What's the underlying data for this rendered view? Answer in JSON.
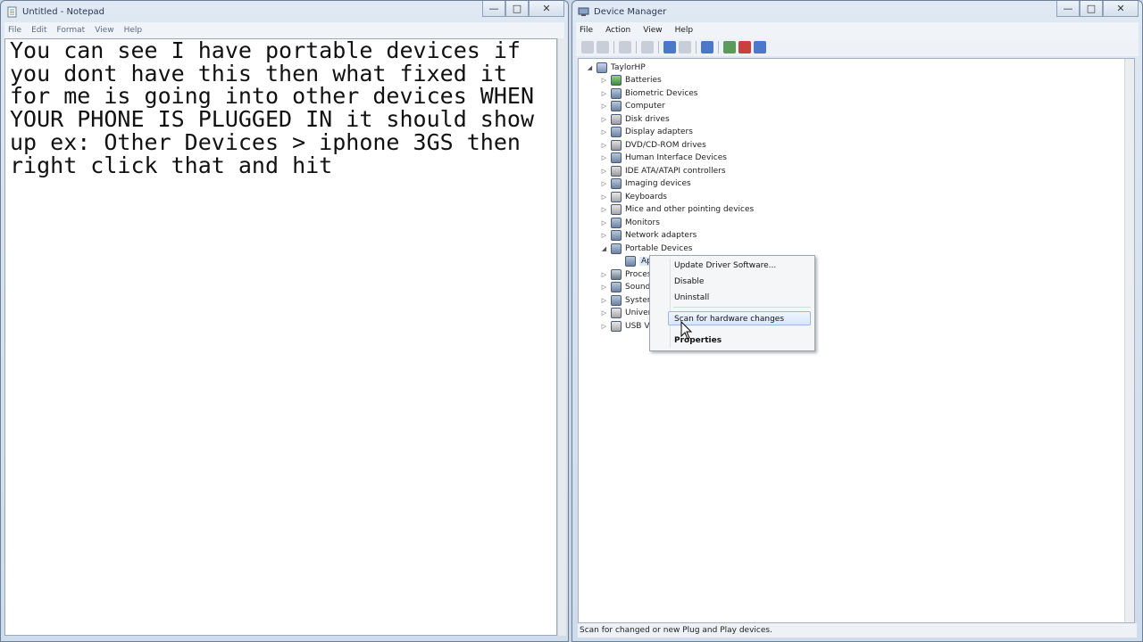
{
  "notepad": {
    "title": "Untitled - Notepad",
    "menu": [
      "File",
      "Edit",
      "Format",
      "View",
      "Help"
    ],
    "content": "You can see I have portable devices if you dont have this then what fixed it for me is going into other devices WHEN YOUR PHONE IS PLUGGED IN it should show up ex: Other Devices > iphone 3GS then right click that and hit"
  },
  "devmgr": {
    "title": "Device Manager",
    "menu": [
      "File",
      "Action",
      "View",
      "Help"
    ],
    "status": "Scan for changed or new Plug and Play devices.",
    "tree": {
      "root": "TaylorHP",
      "items": [
        "Batteries",
        "Biometric Devices",
        "Computer",
        "Disk drives",
        "Display adapters",
        "DVD/CD-ROM drives",
        "Human Interface Devices",
        "IDE ATA/ATAPI controllers",
        "Imaging devices",
        "Keyboards",
        "Mice and other pointing devices",
        "Monitors",
        "Network adapters",
        "Portable Devices",
        "Appl",
        "Proces",
        "Sound,",
        "System",
        "Univer",
        "USB Vi"
      ]
    },
    "context_menu": [
      "Update Driver Software...",
      "Disable",
      "Uninstall",
      "Scan for hardware changes",
      "Properties"
    ]
  }
}
